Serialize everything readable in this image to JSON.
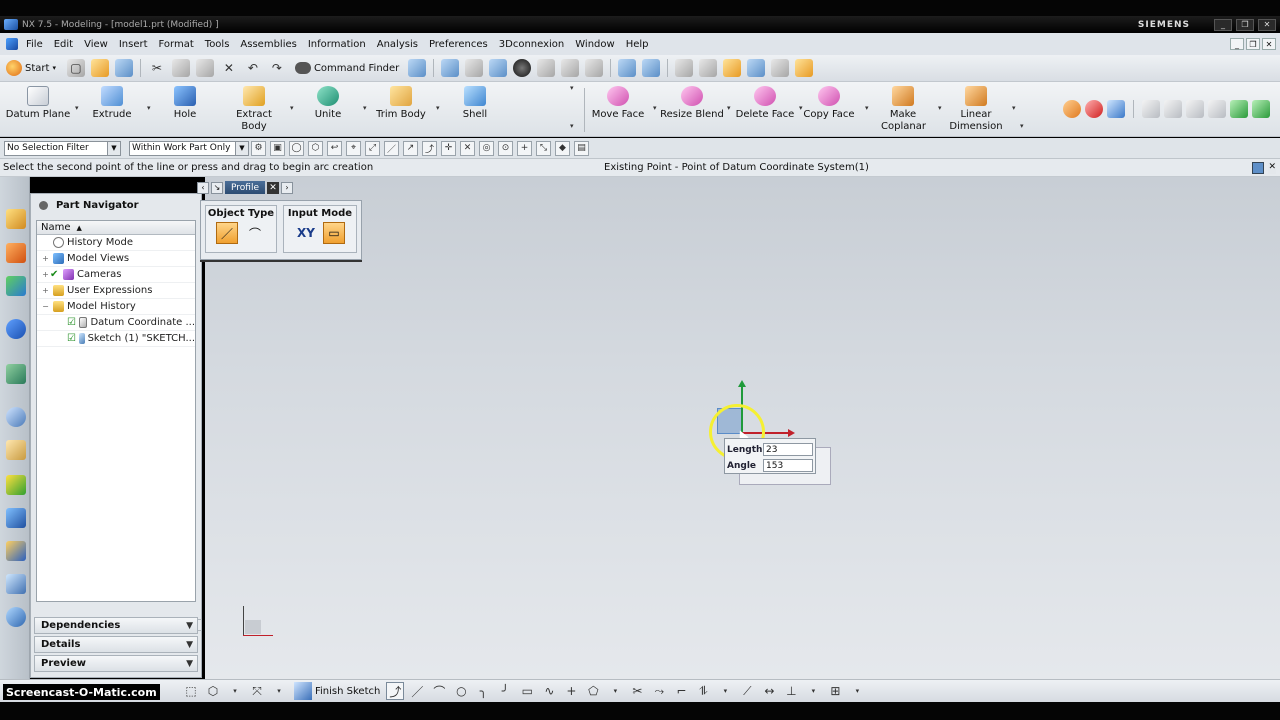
{
  "window": {
    "title": "NX 7.5 - Modeling - [model1.prt (Modified) ]",
    "brand": "SIEMENS",
    "controls": [
      "_",
      "❐",
      "✕"
    ]
  },
  "menu": {
    "items": [
      "File",
      "Edit",
      "View",
      "Insert",
      "Format",
      "Tools",
      "Assemblies",
      "Information",
      "Analysis",
      "Preferences",
      "3Dconnexion",
      "Window",
      "Help"
    ]
  },
  "toolbar_standard": {
    "start_label": "Start",
    "command_finder_label": "Command Finder"
  },
  "toolbar_features": {
    "buttons": [
      {
        "label": "Datum Plane",
        "icon": "datum-plane-icon"
      },
      {
        "label": "Extrude",
        "icon": "extrude-icon"
      },
      {
        "label": "Hole",
        "icon": "hole-icon"
      },
      {
        "label": "Extract Body",
        "icon": "extract-body-icon"
      },
      {
        "label": "Unite",
        "icon": "unite-icon"
      },
      {
        "label": "Trim Body",
        "icon": "trim-body-icon"
      },
      {
        "label": "Shell",
        "icon": "shell-icon"
      },
      {
        "label": "Move Face",
        "icon": "move-face-icon"
      },
      {
        "label": "Resize Blend",
        "icon": "resize-blend-icon"
      },
      {
        "label": "Delete Face",
        "icon": "delete-face-icon"
      },
      {
        "label": "Copy Face",
        "icon": "copy-face-icon"
      },
      {
        "label": "Make Coplanar",
        "icon": "make-coplanar-icon"
      },
      {
        "label": "Linear Dimension",
        "icon": "linear-dimension-icon"
      }
    ]
  },
  "selection_bar": {
    "filter": "No Selection Filter",
    "scope": "Within Work Part Only"
  },
  "status": {
    "prompt": "Select the second point of the line or press and drag to begin arc creation",
    "message": "Existing Point - Point of Datum Coordinate System(1)"
  },
  "part_navigator": {
    "title": "Part Navigator",
    "column_header": "Name",
    "nodes": [
      {
        "label": "History Mode",
        "icon": "clock-icon",
        "expander": "",
        "check": false
      },
      {
        "label": "Model Views",
        "icon": "model-views-icon",
        "expander": "+",
        "check": false
      },
      {
        "label": "Cameras",
        "icon": "camera-icon",
        "expander": "+",
        "check": true
      },
      {
        "label": "User Expressions",
        "icon": "folder-icon",
        "expander": "+",
        "check": false
      },
      {
        "label": "Model History",
        "icon": "folder-icon",
        "expander": "−",
        "check": false
      },
      {
        "label": "Datum Coordinate ...",
        "icon": "datum-csys-icon",
        "expander": "",
        "check": true
      },
      {
        "label": "Sketch (1) \"SKETCH...",
        "icon": "sketch-icon",
        "expander": "",
        "check": true
      }
    ],
    "sections": [
      "Dependencies",
      "Details",
      "Preview"
    ]
  },
  "profile_dialog": {
    "title": "Profile",
    "object_type_label": "Object Type",
    "input_mode_label": "Input Mode",
    "xy_label": "XY"
  },
  "dynamic_input": {
    "length_label": "Length",
    "length_value": "23",
    "angle_label": "Angle",
    "angle_value": "153"
  },
  "sketch_toolbar": {
    "finish_label": "Finish Sketch"
  },
  "watermark": "Screencast-O-Matic.com"
}
